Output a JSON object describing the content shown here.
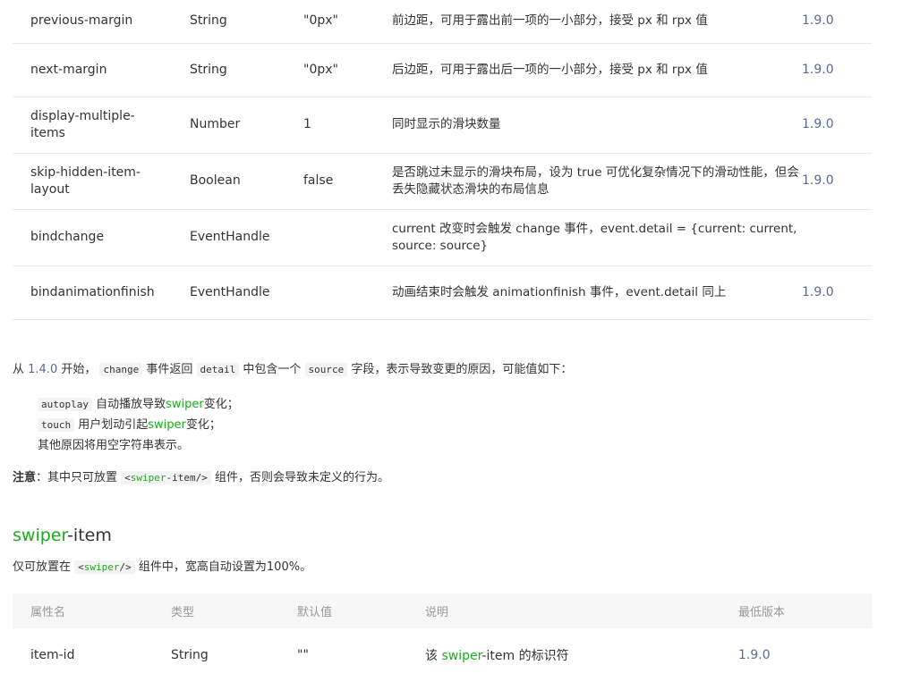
{
  "table1": [
    {
      "name": "previous-margin",
      "type": "String",
      "default": "\"0px\"",
      "desc": "前边距，可用于露出前一项的一小部分，接受 px 和 rpx 值",
      "version": "1.9.0"
    },
    {
      "name": "next-margin",
      "type": "String",
      "default": "\"0px\"",
      "desc": "后边距，可用于露出后一项的一小部分，接受 px 和 rpx 值",
      "version": "1.9.0"
    },
    {
      "name": "display-multiple-items",
      "type": "Number",
      "default": "1",
      "desc": "同时显示的滑块数量",
      "version": "1.9.0"
    },
    {
      "name": "skip-hidden-item-layout",
      "type": "Boolean",
      "default": "false",
      "desc": "是否跳过未显示的滑块布局，设为 true 可优化复杂情况下的滑动性能，但会丢失隐藏状态滑块的布局信息",
      "version": "1.9.0"
    },
    {
      "name": "bindchange",
      "type": "EventHandle",
      "default": "",
      "desc": "current 改变时会触发 change 事件，event.detail = {current: current, source: source}",
      "version": ""
    },
    {
      "name": "bindanimationfinish",
      "type": "EventHandle",
      "default": "",
      "desc": "动画结束时会触发 animationfinish 事件，event.detail 同上",
      "version": "1.9.0"
    }
  ],
  "row_name_lines": {
    "dmi": [
      "display-multiple-",
      "items"
    ],
    "shil": [
      "skip-hidden-item-",
      "layout"
    ]
  },
  "para1": {
    "prefix": "从 ",
    "version": "1.4.0",
    "t1": " 开始， ",
    "code1": "change",
    "t2": " 事件返回 ",
    "code2": "detail",
    "t3": " 中包含一个 ",
    "code3": "source",
    "t4": " 字段，表示导致变更的原因，可能值如下："
  },
  "sources": [
    {
      "code": "autoplay",
      "pre": " 自动播放导致",
      "hl": "swiper",
      "post": "变化；"
    },
    {
      "code": "touch",
      "pre": " 用户划动引起",
      "hl": "swiper",
      "post": "变化；"
    },
    {
      "code": "",
      "pre": "其他原因将用空字符串表示。",
      "hl": "",
      "post": ""
    }
  ],
  "note": {
    "label": "注意",
    "t1": "：其中只可放置 ",
    "code_lt": "<",
    "code_hl": "swiper",
    "code_rest": "-item/>",
    "t2": " 组件，否则会导致未定义的行为。"
  },
  "section2": {
    "title_hl": "swiper",
    "title_rest": "-item",
    "desc_pre": "仅可放置在 ",
    "desc_code_lt": "<",
    "desc_code_hl": "swiper",
    "desc_code_rest": "/>",
    "desc_post": " 组件中，宽高自动设置为100%。"
  },
  "table2": {
    "headers": [
      "属性名",
      "类型",
      "默认值",
      "说明",
      "最低版本"
    ],
    "rows": [
      {
        "name": "item-id",
        "type": "String",
        "default": "\"\"",
        "desc_pre": "该 ",
        "desc_hl": "swiper",
        "desc_post": "-item 的标识符",
        "version": "1.9.0"
      }
    ]
  },
  "colors": {
    "link": "#576b95",
    "highlight": "#1aad19",
    "text": "#333333"
  }
}
